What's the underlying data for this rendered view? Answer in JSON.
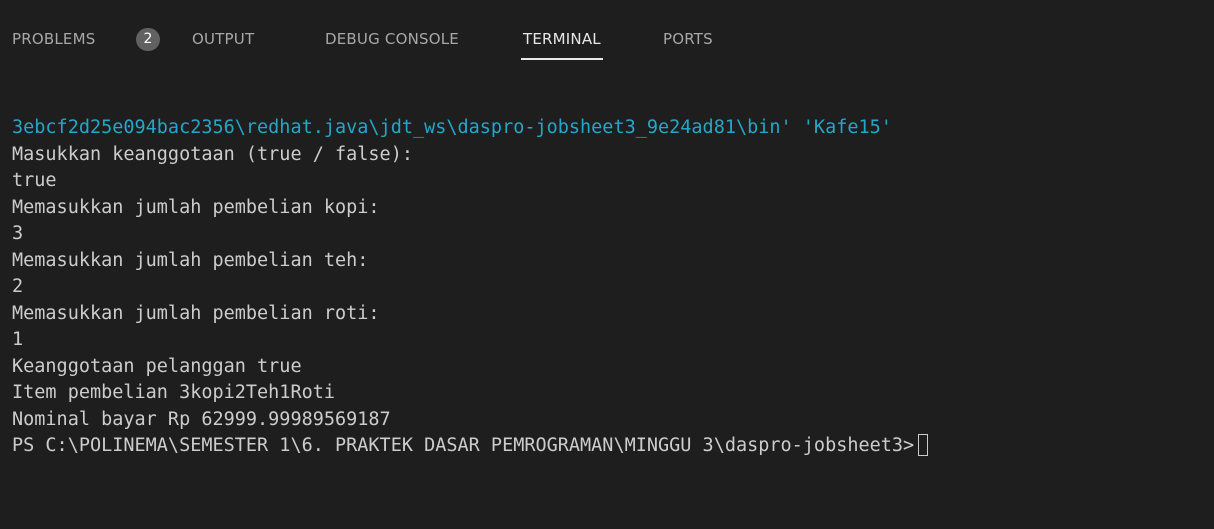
{
  "tabs": [
    {
      "label": "PROBLEMS",
      "badge": "2"
    },
    {
      "label": "OUTPUT"
    },
    {
      "label": "DEBUG CONSOLE"
    },
    {
      "label": "TERMINAL",
      "active": true
    },
    {
      "label": "PORTS"
    }
  ],
  "terminal": {
    "lines": [
      "3ebcf2d25e094bac2356\\redhat.java\\jdt_ws\\daspro-jobsheet3_9e24ad81\\bin' 'Kafe15'",
      "Masukkan keanggotaan (true / false):",
      "true",
      "Memasukkan jumlah pembelian kopi:",
      "3",
      "Memasukkan jumlah pembelian teh:",
      "2",
      "Memasukkan jumlah pembelian roti:",
      "1",
      "Keanggotaan pelanggan true",
      "Item pembelian 3kopi2Teh1Roti",
      "Nominal bayar Rp 62999.99989569187",
      "PS C:\\POLINEMA\\SEMESTER 1\\6. PRAKTEK DASAR PEMROGRAMAN\\MINGGU 3\\daspro-jobsheet3>"
    ]
  },
  "colors": {
    "background": "#1e1e1e",
    "text": "#cccccc",
    "path_text": "#25a6c8",
    "tab_inactive": "#a8a8a8",
    "tab_active": "#e7e7e7",
    "badge_bg": "#616161"
  }
}
